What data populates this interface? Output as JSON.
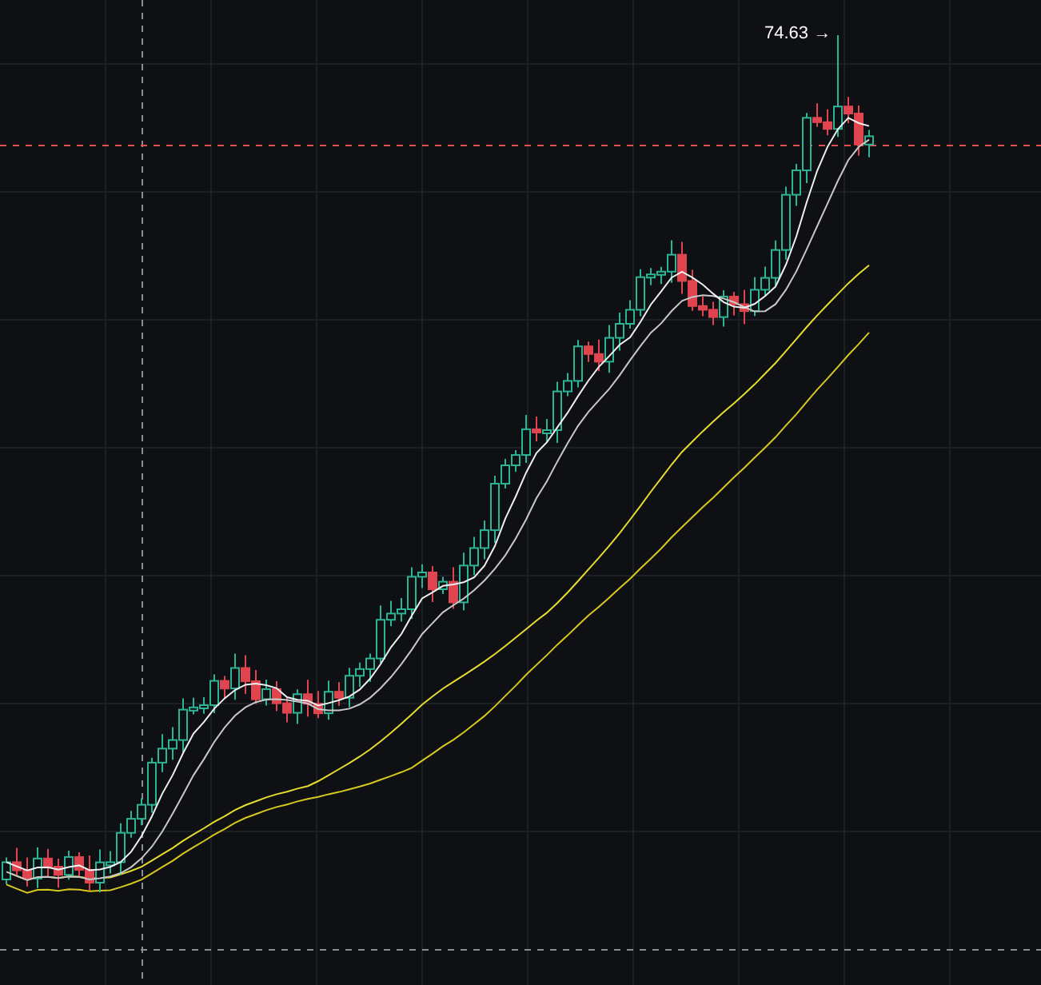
{
  "chart": {
    "high_marker": "74.63 →"
  }
}
